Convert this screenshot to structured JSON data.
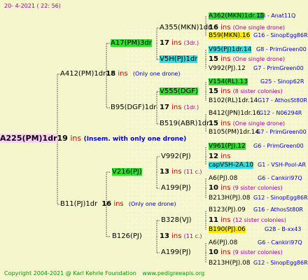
{
  "header": {
    "date": "20-   4-2021  ( 22:  56)"
  },
  "root": {
    "name": "A225(PM)1dr",
    "num": "19",
    "unit": "ins",
    "note": "(Insem. with only one drone)"
  },
  "sire": {
    "name": "A412(PM)1dr",
    "num": "18",
    "unit": "ins",
    "note": "(Only one drone)"
  },
  "dam": {
    "name": "B11(PJ)1dr",
    "num": "16",
    "unit": "ins",
    "note": "(Only one drone)"
  },
  "g3": [
    {
      "name": "A17(PM)3dr",
      "num": "17",
      "unit": "ins",
      "note": "(3dr.)"
    },
    {
      "name": "B95(DGF)1dr",
      "num": "17",
      "unit": "ins",
      "note": "(1dr.)"
    },
    {
      "name": "V216(PJ)",
      "num": "13",
      "unit": "ins",
      "note": "(11 c.)"
    },
    {
      "name": "B126(PJ)",
      "num": "13",
      "unit": "ins",
      "note": "(11 c.)"
    }
  ],
  "g4": [
    {
      "name": "A355(MKN)1dr",
      "num": "16",
      "unit": "ins",
      "note": "(One single drone)"
    },
    {
      "name": "V5H(PJ)1dr",
      "num": "15",
      "unit": "ins",
      "note": "(One single drone)"
    },
    {
      "name": "V555(DGF)",
      "num": "15",
      "unit": "ins",
      "note": "(8 sister colonies)"
    },
    {
      "name": "B519(ABR)1dr",
      "num": "15",
      "unit": "ins",
      "note": "(One single drone)"
    },
    {
      "name": "V992(PJ)",
      "num": "12",
      "unit": "ins",
      "note": ""
    },
    {
      "name": "A199(PJ)",
      "num": "10",
      "unit": "ins",
      "note": "(9 sister colonies)"
    },
    {
      "name": "B328(VJ)",
      "num": "11",
      "unit": "ins",
      "note": "(12 sister colonies)"
    },
    {
      "name": "A199(PJ)",
      "num": "10",
      "unit": "ins",
      "note": "(9 sister colonies)"
    }
  ],
  "g5": [
    {
      "name": "A362(MKN)1dr.15",
      "info": "G3 - Anat11Q"
    },
    {
      "name": "B59(MKN).16",
      "info": "G16 - SinopEgg86R"
    },
    {
      "name": "V95(PJ)1dr.14",
      "info": "G8 - PrimGreen00"
    },
    {
      "name": "V992(PJ).12",
      "info": "G7 - PrimGreen00"
    },
    {
      "name": "V154(RL).13",
      "info": "G25 - Sinop62R"
    },
    {
      "name": "B102(RL)1dr.14",
      "info": "G17 - AthosSt80R"
    },
    {
      "name": "B412(JPN)1dr.16",
      "info": "G12 - N06294R"
    },
    {
      "name": "B105(PM)1dr.14",
      "info": "G7 - PrimGreen00"
    },
    {
      "name": "V961(PJ).12",
      "info": "G6 - PrimGreen00"
    },
    {
      "name": "capVSH-2A.10",
      "info": "G1 - VSH-Pool-AR"
    },
    {
      "name": "A6(PJ).08",
      "info": "G6 - Cankiri97Q"
    },
    {
      "name": "B213H(PJ).08",
      "info": "G12 - SinopEgg86R"
    },
    {
      "name": "B123(PJ).09",
      "info": "G16 - AthosSt80R"
    },
    {
      "name": "B190(PJ).06",
      "info": "G28 - B-xx43"
    },
    {
      "name": "A6(PJ).08",
      "info": "G6 - Cankiri97Q"
    },
    {
      "name": "B213H(PJ).08",
      "info": "G12 - SinopEgg86R"
    }
  ],
  "footer": {
    "copyright": "Copyright 2004-2021 @ Karl Kehrle Foundation",
    "site": "www.pedigreeapis.org"
  }
}
